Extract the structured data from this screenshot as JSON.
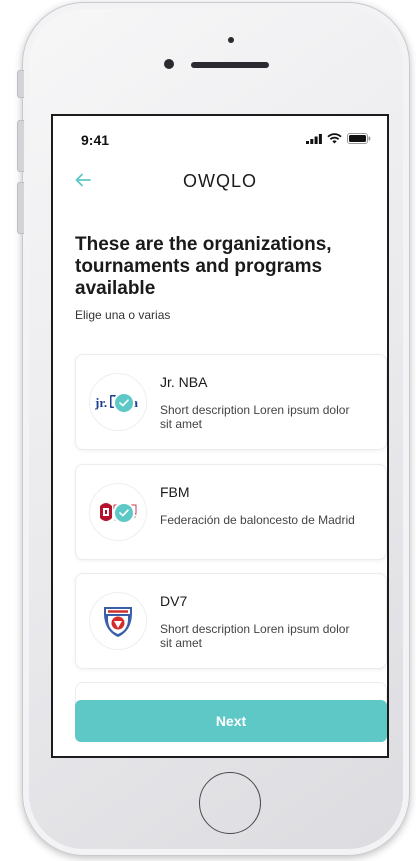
{
  "status_bar": {
    "time": "9:41"
  },
  "nav": {
    "brand": "OWQLO",
    "back_icon": "arrow-left-icon"
  },
  "header": {
    "title": "These are the organizations, tournaments and programs available",
    "subtitle": "Elige una o varias"
  },
  "organizations": [
    {
      "name": "Jr. NBA",
      "description": "Short description Loren ipsum dolor sit amet",
      "logo_text": "jr.nba",
      "selected": true
    },
    {
      "name": "FBM",
      "description": "Federación de baloncesto de Madrid",
      "logo_text": "FBM",
      "selected": true
    },
    {
      "name": "DV7",
      "description": "Short description Loren ipsum dolor sit amet",
      "logo_text": "",
      "selected": false
    }
  ],
  "actions": {
    "next_label": "Next"
  },
  "colors": {
    "accent": "#5ec8c6",
    "text": "#1a1a1a"
  }
}
